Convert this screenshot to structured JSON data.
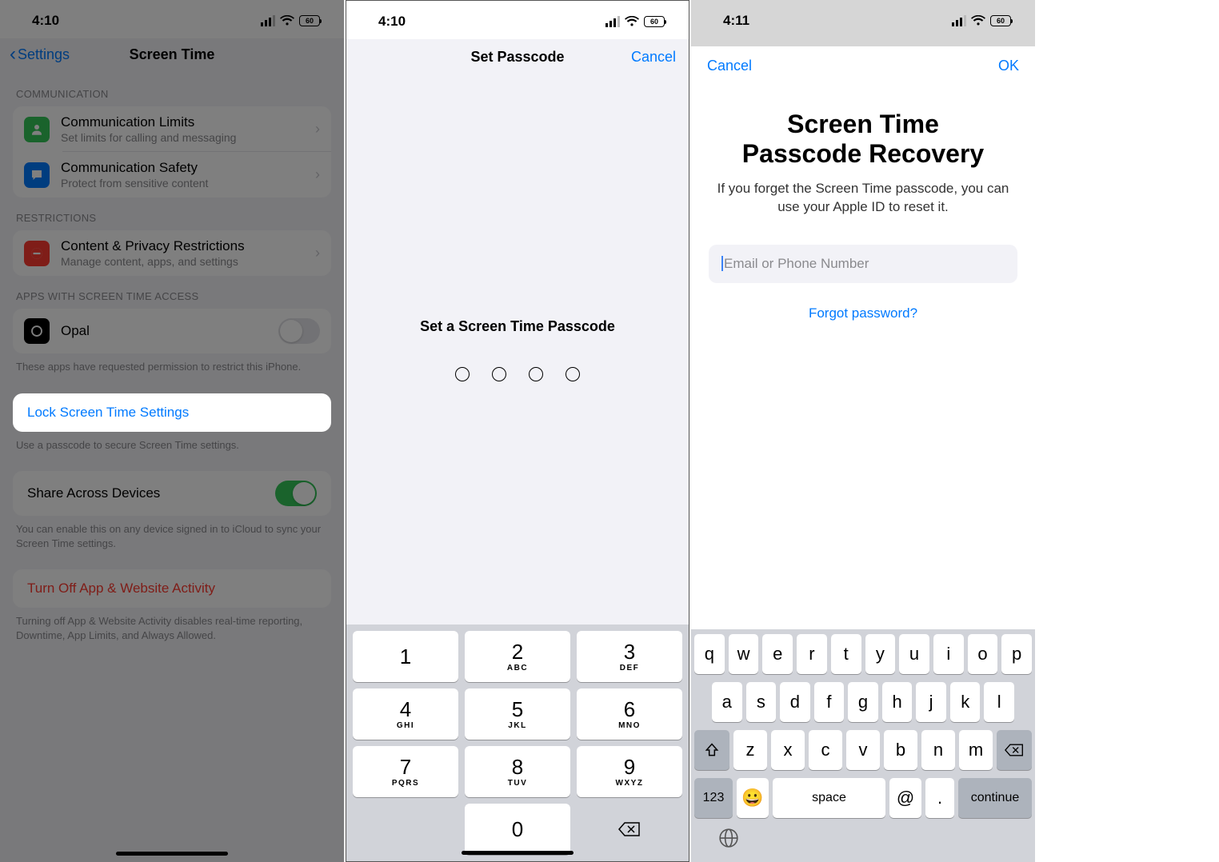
{
  "status": {
    "time1": "4:10",
    "time2": "4:10",
    "time3": "4:11",
    "battery": "60"
  },
  "s1": {
    "nav_back": "Settings",
    "nav_title": "Screen Time",
    "sec_comm": "COMMUNICATION",
    "comm_limits_title": "Communication Limits",
    "comm_limits_sub": "Set limits for calling and messaging",
    "comm_safety_title": "Communication Safety",
    "comm_safety_sub": "Protect from sensitive content",
    "sec_restrictions": "RESTRICTIONS",
    "restr_title": "Content & Privacy Restrictions",
    "restr_sub": "Manage content, apps, and settings",
    "sec_apps": "APPS WITH SCREEN TIME ACCESS",
    "opal": "Opal",
    "apps_footer": "These apps have requested permission to restrict this iPhone.",
    "lock_label": "Lock Screen Time Settings",
    "lock_footer": "Use a passcode to secure Screen Time settings.",
    "share_label": "Share Across Devices",
    "share_footer": "You can enable this on any device signed in to iCloud to sync your Screen Time settings.",
    "turnoff_label": "Turn Off App & Website Activity",
    "turnoff_footer": "Turning off App & Website Activity disables real-time reporting, Downtime, App Limits, and Always Allowed."
  },
  "s2": {
    "nav_title": "Set Passcode",
    "cancel": "Cancel",
    "prompt": "Set a Screen Time Passcode",
    "numpad": [
      {
        "d": "1",
        "l": ""
      },
      {
        "d": "2",
        "l": "ABC"
      },
      {
        "d": "3",
        "l": "DEF"
      },
      {
        "d": "4",
        "l": "GHI"
      },
      {
        "d": "5",
        "l": "JKL"
      },
      {
        "d": "6",
        "l": "MNO"
      },
      {
        "d": "7",
        "l": "PQRS"
      },
      {
        "d": "8",
        "l": "TUV"
      },
      {
        "d": "9",
        "l": "WXYZ"
      },
      {
        "d": "",
        "l": ""
      },
      {
        "d": "0",
        "l": ""
      },
      {
        "d": "⌫",
        "l": ""
      }
    ]
  },
  "s3": {
    "cancel": "Cancel",
    "ok": "OK",
    "title_l1": "Screen Time",
    "title_l2": "Passcode Recovery",
    "desc": "If you forget the Screen Time passcode, you can use your Apple ID to reset it.",
    "placeholder": "Email or Phone Number",
    "forgot": "Forgot password?",
    "row1": [
      "q",
      "w",
      "e",
      "r",
      "t",
      "y",
      "u",
      "i",
      "o",
      "p"
    ],
    "row2": [
      "a",
      "s",
      "d",
      "f",
      "g",
      "h",
      "j",
      "k",
      "l"
    ],
    "row3": [
      "z",
      "x",
      "c",
      "v",
      "b",
      "n",
      "m"
    ],
    "k123": "123",
    "space": "space",
    "at": "@",
    "dot": ".",
    "continue": "continue"
  }
}
